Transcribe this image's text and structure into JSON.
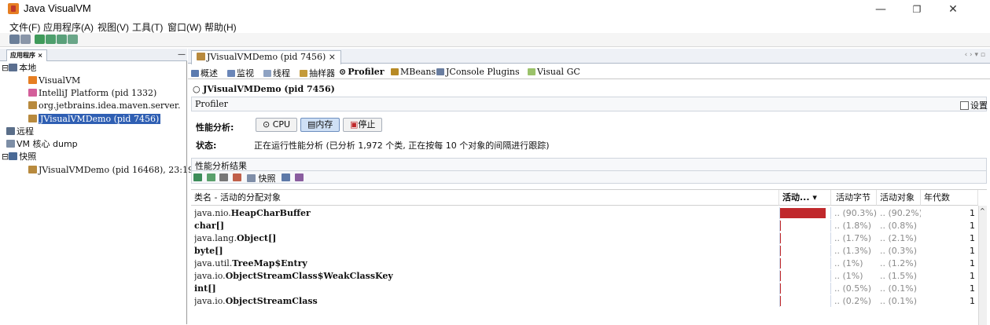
{
  "window": {
    "title": "Java VisualVM",
    "controls": {
      "minimize": "—",
      "restore": "❐",
      "close": "✕"
    }
  },
  "menu": [
    "文件(F)",
    "应用程序(A)",
    "视图(V)",
    "工具(T)",
    "窗口(W)",
    "帮助(H)"
  ],
  "left_panel": {
    "tab_label": "应用程序 ×",
    "minimize_label": "—",
    "tree": [
      {
        "label": "本地",
        "icon": "computer-icon",
        "level": 0,
        "toggle": "⊟"
      },
      {
        "label": "VisualVM",
        "icon": "visualvm-icon",
        "level": 1
      },
      {
        "label": "IntelliJ Platform (pid 1332)",
        "icon": "intellij-icon",
        "level": 1
      },
      {
        "label": "org.jetbrains.idea.maven.server.",
        "icon": "java-app-icon",
        "level": 1
      },
      {
        "label": "JVisualVMDemo (pid 7456)",
        "icon": "java-app-icon",
        "level": 1,
        "selected": true
      },
      {
        "label": "远程",
        "icon": "remote-icon",
        "level": 0
      },
      {
        "label": "VM 核心 dump",
        "icon": "coredump-icon",
        "level": 0
      },
      {
        "label": "快照",
        "icon": "snapshot-icon",
        "level": 0,
        "toggle": "⊟"
      },
      {
        "label": "JVisualVMDemo (pid 16468), 23:19",
        "icon": "java-app-icon",
        "level": 1
      }
    ]
  },
  "doc_tab": {
    "label": "JVisualVMDemo (pid 7456) ×",
    "controls": "‹ › ▾ ▫"
  },
  "sub_tabs": [
    {
      "label": "概述",
      "icon": "overview-icon"
    },
    {
      "label": "监视",
      "icon": "monitor-icon"
    },
    {
      "label": "线程",
      "icon": "threads-icon"
    },
    {
      "label": "抽样器",
      "icon": "sampler-icon"
    },
    {
      "label": "Profiler",
      "icon": "profiler-icon"
    },
    {
      "label": "MBeans",
      "icon": "mbeans-icon"
    },
    {
      "label": "JConsole Plugins",
      "icon": "jconsole-icon"
    },
    {
      "label": "Visual GC",
      "icon": "visualgc-icon"
    }
  ],
  "app_header": "JVisualVMDemo (pid 7456)",
  "profiler": {
    "title": "Profiler",
    "settings_label": "设置",
    "analysis_label": "性能分析:",
    "buttons": {
      "cpu": "CPU",
      "memory": "内存",
      "stop": "停止"
    },
    "status_label": "状态:",
    "status_text": "正在运行性能分析 (已分析 1,972 个类, 正在按每 10 个对象的间隔进行跟踪)"
  },
  "results": {
    "title": "性能分析结果",
    "snapshot_label": "快照",
    "columns": {
      "name": "类名 - 活动的分配对象",
      "live": "活动... ▾",
      "live_bytes": "活动字节",
      "live_objects": "活动对象",
      "generations": "年代数"
    },
    "rows": [
      {
        "pkg": "java.nio.",
        "cls": "HeapCharBuffer",
        "bar": 0.903,
        "bytes": "(90.3%)",
        "objects": "(90.2%)",
        "gen": "1"
      },
      {
        "pkg": "",
        "cls": "char[]",
        "bar": 0.018,
        "bytes": "(1.8%)",
        "objects": "(0.8%)",
        "gen": "1"
      },
      {
        "pkg": "java.lang.",
        "cls": "Object[]",
        "bar": 0.017,
        "bytes": "(1.7%)",
        "objects": "(2.1%)",
        "gen": "1"
      },
      {
        "pkg": "",
        "cls": "byte[]",
        "bar": 0.013,
        "bytes": "(1.3%)",
        "objects": "(0.3%)",
        "gen": "1"
      },
      {
        "pkg": "java.util.",
        "cls": "TreeMap$Entry",
        "bar": 0.01,
        "bytes": "(1%)",
        "objects": "(1.2%)",
        "gen": "1"
      },
      {
        "pkg": "java.io.",
        "cls": "ObjectStreamClass$WeakClassKey",
        "bar": 0.01,
        "bytes": "(1%)",
        "objects": "(1.5%)",
        "gen": "1"
      },
      {
        "pkg": "",
        "cls": "int[]",
        "bar": 0.005,
        "bytes": "(0.5%)",
        "objects": "(0.1%)",
        "gen": "1"
      },
      {
        "pkg": "java.io.",
        "cls": "ObjectStreamClass",
        "bar": 0.002,
        "bytes": "(0.2%)",
        "objects": "(0.1%)",
        "gen": "1"
      }
    ]
  },
  "colors": {
    "selection": "#2f5fb3",
    "bar": "#c0282b",
    "accent": "#6d8fbf"
  }
}
